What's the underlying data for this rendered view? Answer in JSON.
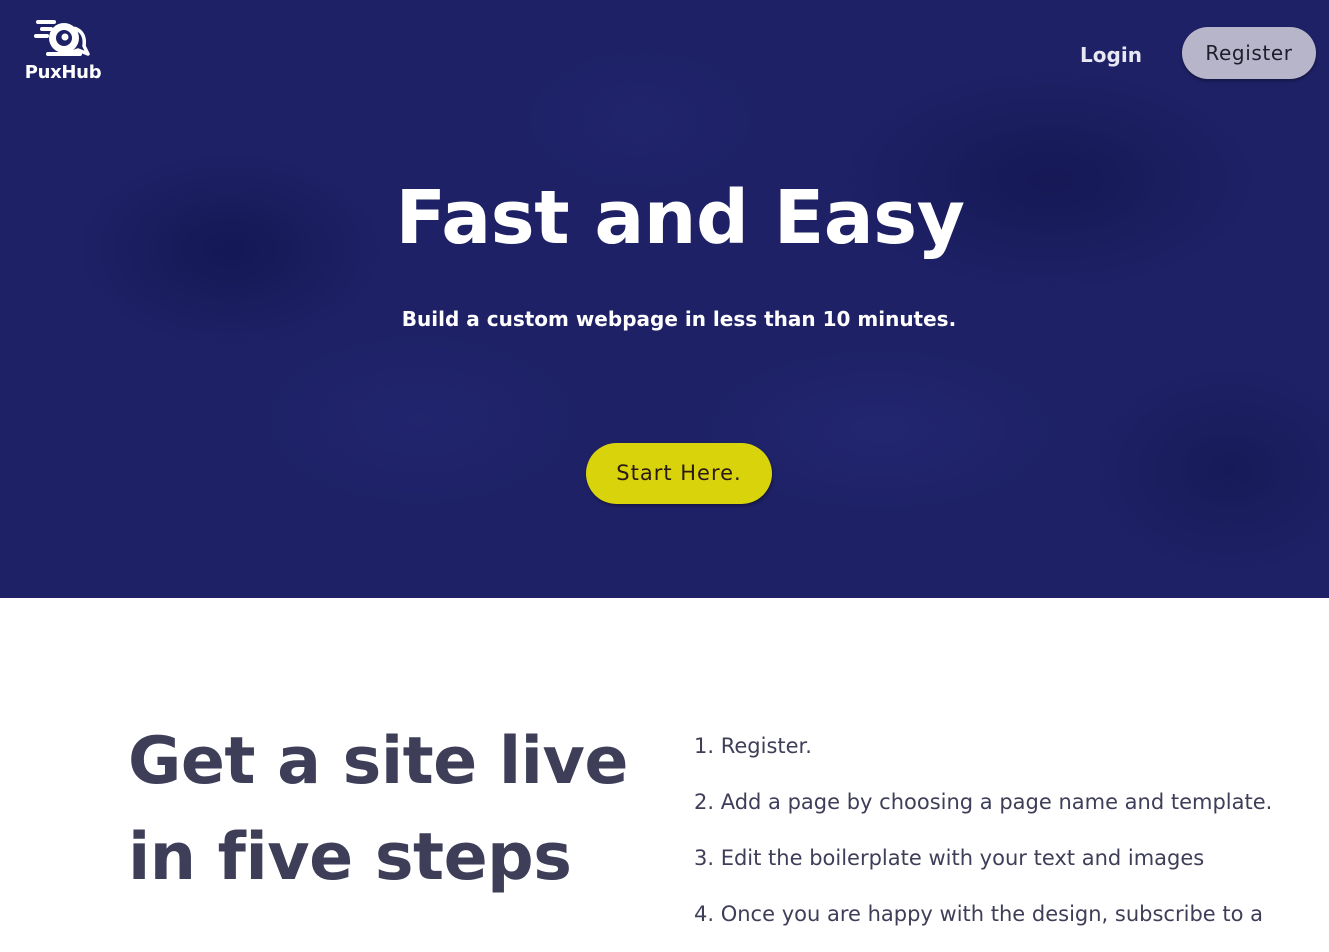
{
  "header": {
    "logo_text": "PuxHub",
    "login_label": "Login",
    "register_label": "Register"
  },
  "hero": {
    "title": "Fast and Easy",
    "subtitle": "Build a custom webpage in less than 10 minutes.",
    "cta_label": "Start Here."
  },
  "steps": {
    "heading_line1": "Get a site live",
    "heading_line2": "in five steps",
    "items": [
      "1. Register.",
      "2. Add a page by choosing a page name and template.",
      "3. Edit the boilerplate with your text and images",
      "4. Once you are happy with the design, subscribe to a"
    ]
  },
  "colors": {
    "hero_background": "#1e2166",
    "cta_background": "#d9d30c",
    "register_background": "#b7b5c9",
    "heading_text": "#3e3e58"
  },
  "icons": {
    "logo": "puxhub-logo-icon"
  }
}
